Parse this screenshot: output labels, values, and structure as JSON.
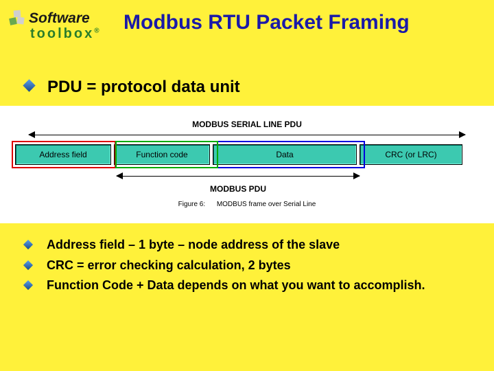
{
  "logo": {
    "software": "Software",
    "toolbox": "toolbox",
    "reg": "®"
  },
  "title": "Modbus RTU Packet Framing",
  "top_bullet": "PDU = protocol data unit",
  "diagram": {
    "serial_label": "MODBUS SERIAL LINE PDU",
    "pdu_label": "MODBUS PDU",
    "cells": {
      "address": "Address field",
      "function": "Function code",
      "data": "Data",
      "crc": "CRC (or LRC)"
    },
    "caption_prefix": "Figure 6:",
    "caption": "MODBUS frame over Serial Line"
  },
  "bottom_bullets": [
    "Address field – 1 byte – node address of the slave",
    "CRC = error checking calculation, 2 bytes",
    "Function Code + Data depends on what you want to accomplish."
  ]
}
